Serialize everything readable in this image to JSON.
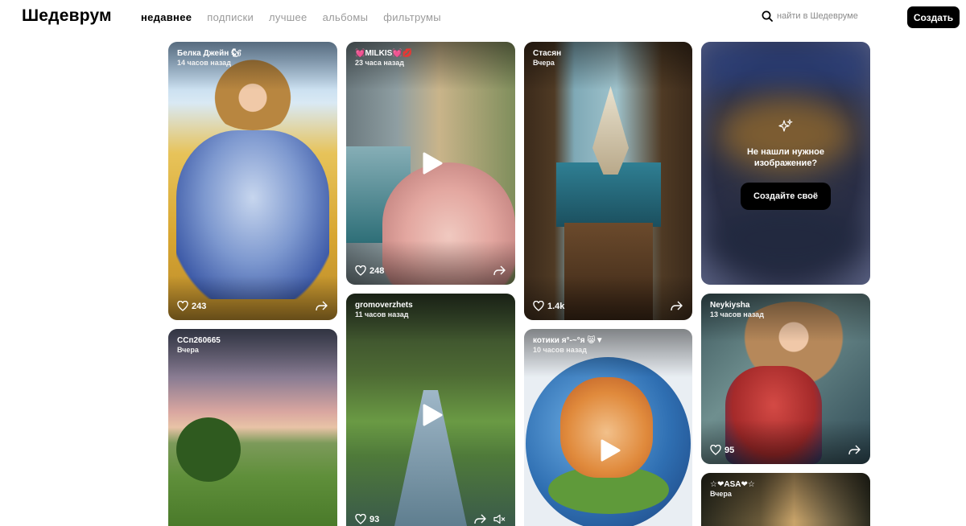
{
  "header": {
    "logo": "Шедеврум",
    "nav": [
      "недавнее",
      "подписки",
      "лучшее",
      "альбомы",
      "фильтрумы"
    ],
    "active_nav": "недавнее",
    "search_placeholder": "найти в Шедевруме",
    "create_label": "Создать"
  },
  "cards": {
    "c1": {
      "author": "Белка Джейн 🐿",
      "time": "14 часов назад",
      "likes": "243"
    },
    "c2": {
      "author": "💓MILKIS💓💋",
      "time": "23 часа назад",
      "likes": "248"
    },
    "c3": {
      "author": "Стасян",
      "time": "Вчера",
      "likes": "1.4k"
    },
    "c4": {
      "author": "ССп260665",
      "time": "Вчера"
    },
    "c5": {
      "author": "gromoverzhets",
      "time": "11 часов назад",
      "likes": "93"
    },
    "c6": {
      "author": "котики ᴙ°-~°ᴙ 😸▼",
      "time": "10 часов назад"
    },
    "c7": {
      "author": "Neykiysha",
      "time": "13 часов назад",
      "likes": "95"
    },
    "c8": {
      "author": "☆❤ASA❤☆",
      "time": "Вчера"
    }
  },
  "promo": {
    "line1": "Не нашли нужное",
    "line2": "изображение?",
    "button": "Создайте своё"
  },
  "icons": [
    "search-icon",
    "heart-icon",
    "share-icon",
    "play-icon",
    "mute-icon",
    "sparkle-icon"
  ],
  "colors": {
    "accent": "#000000",
    "muted_nav": "#9a9a9a"
  }
}
